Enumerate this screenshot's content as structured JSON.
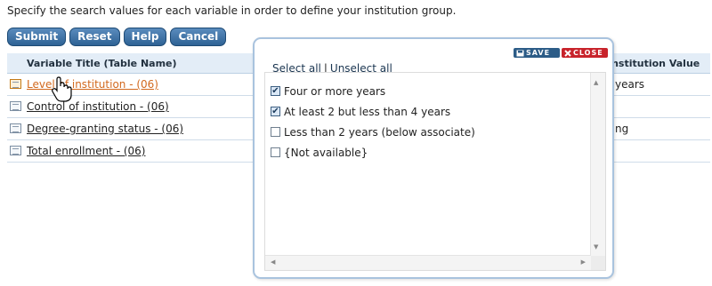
{
  "instructions": "Specify the search values for each variable in order to define your institution group.",
  "buttons": {
    "submit": "Submit",
    "reset": "Reset",
    "help": "Help",
    "cancel": "Cancel"
  },
  "table": {
    "headers": {
      "variable_title": "Variable Title (Table Name)",
      "institution_value": "Institution Value"
    },
    "rows": [
      {
        "label": "Level of institution  - (06)",
        "value": "years",
        "active": true
      },
      {
        "label": "Control of institution  - (06)",
        "value": ""
      },
      {
        "label": "Degree-granting status  - (06)",
        "value": "ng"
      },
      {
        "label": "Total enrollment  - (06)",
        "value": ""
      }
    ]
  },
  "popup": {
    "save_label": "SAVE",
    "close_label": "CLOSE",
    "select_all": "Select all",
    "separator": "|",
    "unselect_all": "Unselect all",
    "options": [
      {
        "label": "Four or more years",
        "checked": true
      },
      {
        "label": "At least 2 but less than 4 years",
        "checked": true
      },
      {
        "label": "Less than 2 years (below associate)",
        "checked": false
      },
      {
        "label": "{Not available}",
        "checked": false
      }
    ]
  },
  "colors": {
    "button_bg": "#2e6294",
    "header_bg": "#e3edf7",
    "active_link": "#d2691e",
    "save_bg": "#2c5c87",
    "close_bg": "#c8232b",
    "popup_border": "#a9c3de"
  }
}
